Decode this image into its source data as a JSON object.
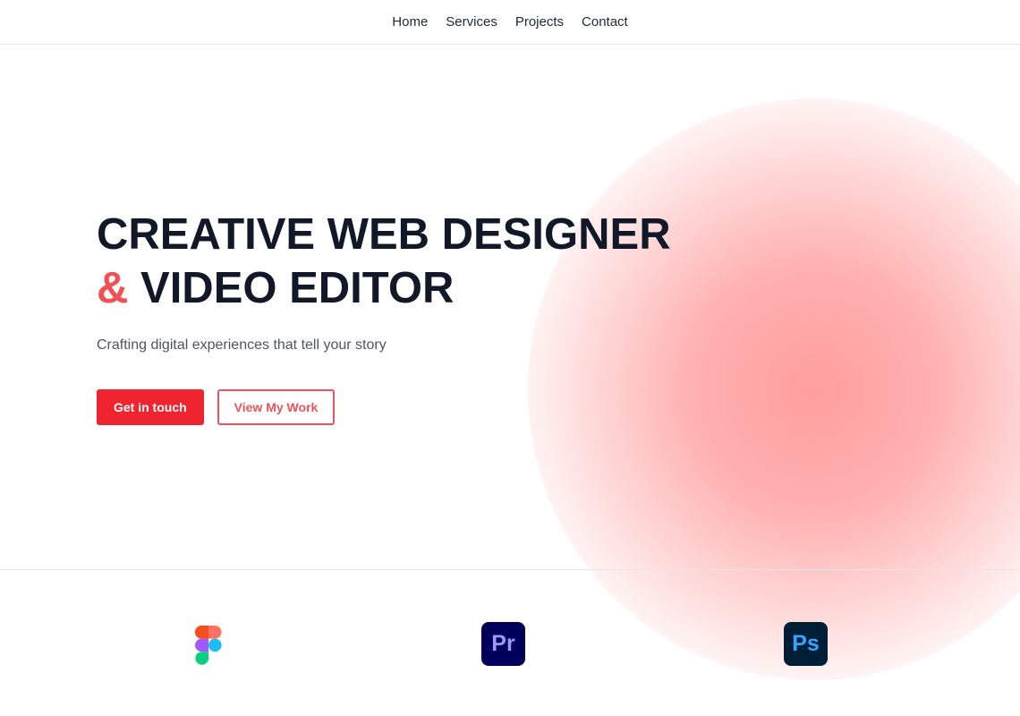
{
  "nav": {
    "items": [
      {
        "label": "Home"
      },
      {
        "label": "Services"
      },
      {
        "label": "Projects"
      },
      {
        "label": "Contact"
      }
    ]
  },
  "hero": {
    "headline_line1": "CREATIVE WEB DESIGNER",
    "headline_amp": "&",
    "headline_line2": "VIDEO EDITOR",
    "subtitle": "Crafting digital experiences that tell your story",
    "primary_cta": "Get in touch",
    "secondary_cta": "View My Work"
  },
  "tools": [
    {
      "name": "figma-icon"
    },
    {
      "name": "premiere-pro-icon",
      "label": "Pr"
    },
    {
      "name": "photoshop-icon",
      "label": "Ps"
    }
  ],
  "colors": {
    "accent": "#f05252",
    "primary_button": "#f0242f",
    "outline_button": "#e8555d",
    "glow": "#ff9a9a",
    "text": "#111827"
  }
}
